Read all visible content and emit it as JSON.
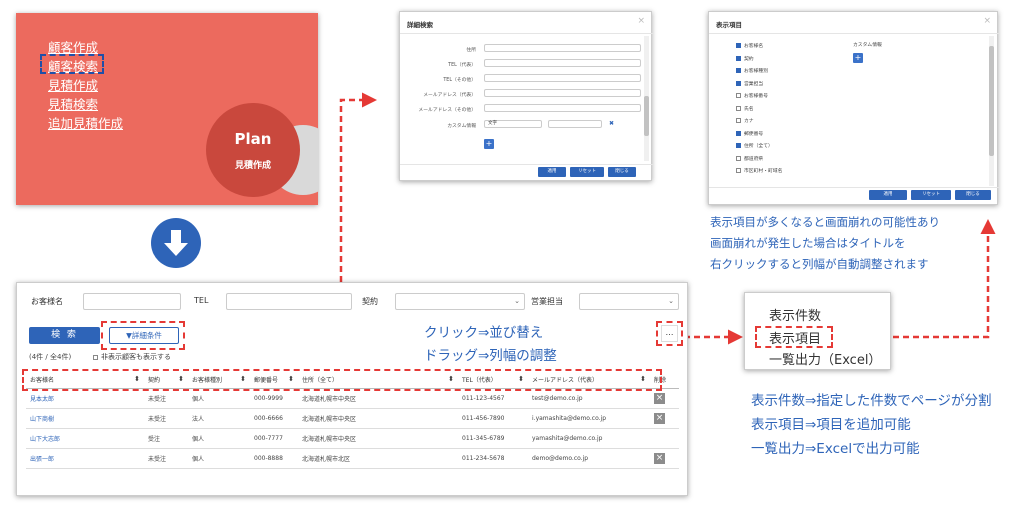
{
  "menu_panel": {
    "items": [
      "顧客作成",
      "顧客検索",
      "見積作成",
      "見積検索",
      "追加見積作成"
    ],
    "plan_title": "Plan",
    "plan_subtitle": "見積作成"
  },
  "search_modal": {
    "title": "詳細検索",
    "labels": [
      "住所",
      "TEL（代表）",
      "TEL（その他）",
      "メールアドレス（代表）",
      "メールアドレス（その他）",
      "カスタム情報"
    ],
    "custom_select_value": "文字",
    "buttons": [
      "適用",
      "リセット",
      "閉じる"
    ]
  },
  "items_modal": {
    "title": "表示項目",
    "custom_label": "カスタム情報",
    "items": [
      {
        "label": "お客様名",
        "checked": true
      },
      {
        "label": "契約",
        "checked": true
      },
      {
        "label": "お客様種別",
        "checked": true
      },
      {
        "label": "営業担当",
        "checked": true
      },
      {
        "label": "お客様番号",
        "checked": false
      },
      {
        "label": "氏名",
        "checked": false
      },
      {
        "label": "カナ",
        "checked": false
      },
      {
        "label": "郵便番号",
        "checked": true
      },
      {
        "label": "住所（全て）",
        "checked": true
      },
      {
        "label": "都道府県",
        "checked": false
      },
      {
        "label": "市区町村・町域名",
        "checked": false
      }
    ],
    "buttons": [
      "適用",
      "リセット",
      "閉じる"
    ]
  },
  "main": {
    "fields": {
      "customer_name_label": "お客様名",
      "tel_label": "TEL",
      "contract_label": "契約",
      "sales_label": "営業担当"
    },
    "search_button": "検 索",
    "detail_button": "▼詳細条件",
    "count_text": "(4件 / 全4件)",
    "show_hidden_label": "非表示顧客も表示する",
    "more_button": "…",
    "table": {
      "headers": [
        "お客様名",
        "契約",
        "お客様種別",
        "郵便番号",
        "住所（全て）",
        "TEL（代表）",
        "メールアドレス（代表）",
        "削除"
      ],
      "rows": [
        [
          "見本太郎",
          "未受注",
          "個人",
          "000-9999",
          "北海道札幌市中央区",
          "011-123-4567",
          "test@demo.co.jp",
          true
        ],
        [
          "山下商樹",
          "未受注",
          "法人",
          "000-6666",
          "北海道札幌市中央区",
          "011-456-7890",
          "i.yamashita@demo.co.jp",
          true
        ],
        [
          "山下大志郎",
          "受注",
          "個人",
          "000-7777",
          "北海道札幌市中央区",
          "011-345-6789",
          "yamashita@demo.co.jp",
          false
        ],
        [
          "出張一郎",
          "未受注",
          "個人",
          "000-8888",
          "北海道札幌市北区",
          "011-234-5678",
          "demo@demo.co.jp",
          true
        ]
      ]
    }
  },
  "context_menu": {
    "items": [
      "表示件数",
      "表示項目",
      "一覧出力（Excel）"
    ]
  },
  "annotations": {
    "items_note": [
      "表示項目が多くなると画面崩れの可能性あり",
      "画面崩れが発生した場合はタイトルを",
      "右クリックすると列幅が自動調整されます"
    ],
    "sort_note": [
      "クリック⇒並び替え",
      "ドラッグ⇒列幅の調整"
    ],
    "menu_note": [
      "表示件数⇒指定した件数でページが分割",
      "表示項目⇒項目を追加可能",
      "一覧出力⇒Excelで出力可能"
    ]
  },
  "colors": {
    "accent_blue": "#2e64b8",
    "highlight_red": "#e53935",
    "menu_panel_red": "#ec6a5e"
  }
}
